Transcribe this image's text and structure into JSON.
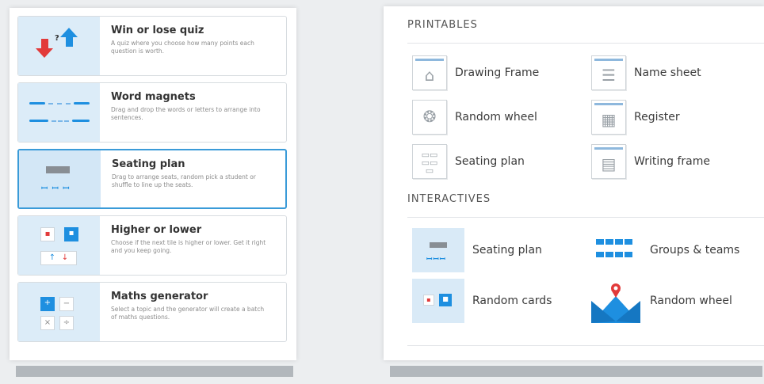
{
  "left": {
    "cards": [
      {
        "title": "Win or lose quiz",
        "desc": "A quiz where you choose how many points each question is worth.",
        "icon": "arrows-updown-icon"
      },
      {
        "title": "Word magnets",
        "desc": "Drag and drop the words or letters to arrange into sentences.",
        "icon": "word-magnets-icon"
      },
      {
        "title": "Seating plan",
        "desc": "Drag to arrange seats, random pick a student or shuffle to line up the seats.",
        "icon": "seating-plan-icon"
      },
      {
        "title": "Higher or lower",
        "desc": "Choose if the next tile is higher or lower. Get it right and you keep going.",
        "icon": "higher-lower-icon"
      },
      {
        "title": "Maths generator",
        "desc": "Select a topic and the generator will create a batch of maths questions.",
        "icon": "maths-generator-icon"
      }
    ]
  },
  "right": {
    "printables_heading": "PRINTABLES",
    "interactives_heading": "INTERACTIVES",
    "printables": [
      {
        "label": "Drawing Frame",
        "icon": "drawing-frame-icon"
      },
      {
        "label": "Name sheet",
        "icon": "name-sheet-icon"
      },
      {
        "label": "Random wheel",
        "icon": "random-wheel-icon"
      },
      {
        "label": "Register",
        "icon": "register-icon"
      },
      {
        "label": "Seating plan",
        "icon": "seating-plan-icon"
      },
      {
        "label": "Writing frame",
        "icon": "writing-frame-icon"
      }
    ],
    "interactives": [
      {
        "label": "Seating plan",
        "icon": "seating-plan-icon"
      },
      {
        "label": "Groups & teams",
        "icon": "groups-teams-icon"
      },
      {
        "label": "Random cards",
        "icon": "random-cards-icon"
      },
      {
        "label": "Random wheel",
        "icon": "random-wheel-icon"
      }
    ]
  },
  "colors": {
    "accent": "#1e8fe0",
    "red": "#e23a3a",
    "selected_border": "#3a9bd8",
    "thumb_bg": "#dcecf8"
  }
}
